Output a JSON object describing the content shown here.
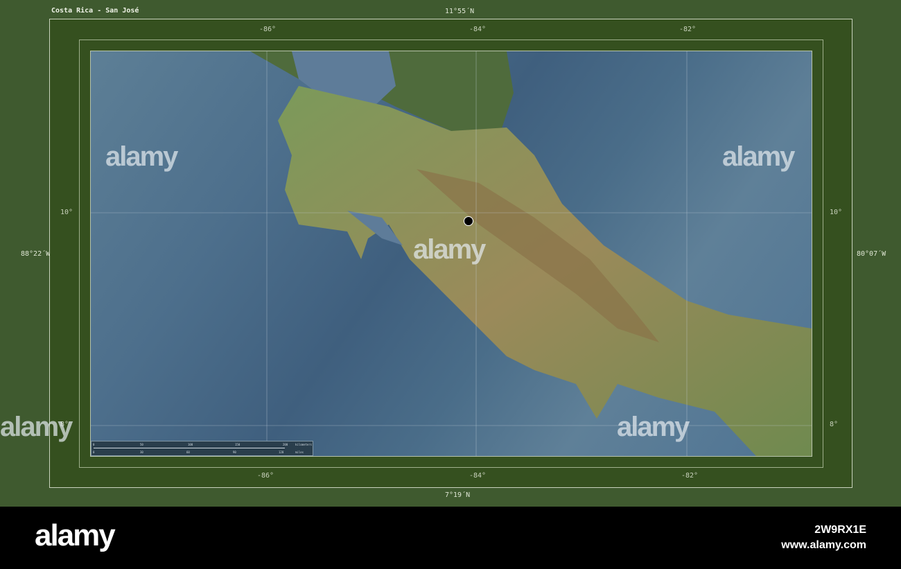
{
  "title": "Costa Rica - San José",
  "top_latitude": "11°55´N",
  "bottom_latitude": "7°19´N",
  "left_longitude": "88°22´W",
  "right_longitude": "80°07´W",
  "lon_ticks": [
    "-86°",
    "-84°",
    "-82°"
  ],
  "lat_ticks": [
    "10°",
    "8°"
  ],
  "scale": {
    "km_labels": [
      "0",
      "50",
      "100",
      "150",
      "200"
    ],
    "km_unit": "kilometers",
    "mi_labels": [
      "0",
      "30",
      "60",
      "90",
      "120"
    ],
    "mi_unit": "miles"
  },
  "city": "San José",
  "watermark": "alamy",
  "footer": {
    "logo": "alamy",
    "image_id": "2W9RX1E",
    "site": "www.alamy.com"
  },
  "colors": {
    "frame": "#3f5a2f",
    "sea": "#4d6f8c",
    "land": "#6f8a4f"
  }
}
